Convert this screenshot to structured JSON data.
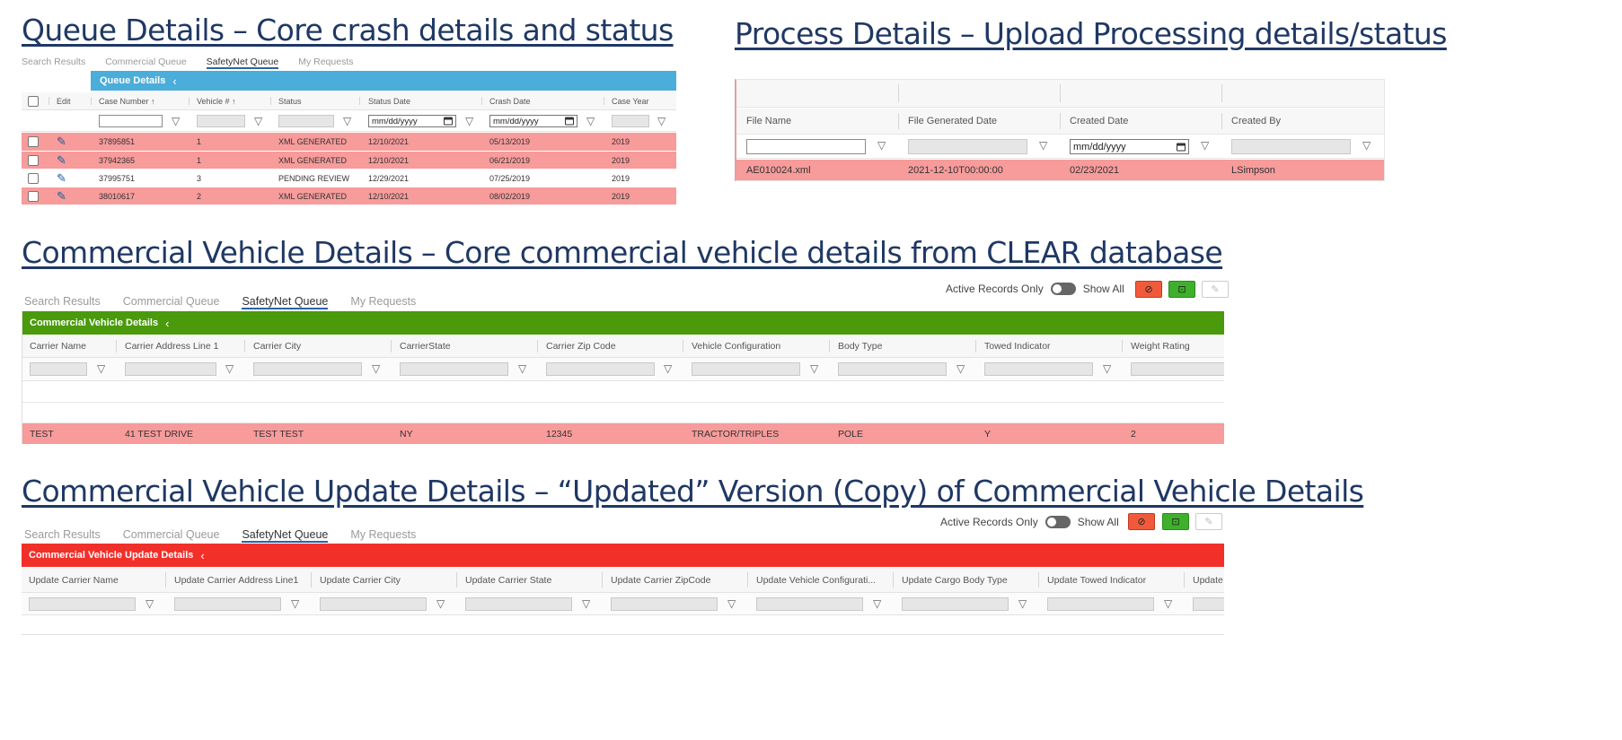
{
  "headings": {
    "queue": "Queue Details – Core crash details and status",
    "process": "Process Details – Upload Processing details/status",
    "commercial": "Commercial Vehicle Details – Core commercial vehicle details from CLEAR database",
    "update": "Commercial Vehicle Update Details – “Updated” Version (Copy) of Commercial Vehicle Details"
  },
  "tabs": [
    "Search Results",
    "Commercial Queue",
    "SafetyNet Queue",
    "My Requests"
  ],
  "queue": {
    "bar_title": "Queue Details",
    "bar_color": "#4badd9",
    "columns": [
      "Edit",
      "Case Number ↑",
      "Vehicle # ↑",
      "Status",
      "Status Date",
      "Crash Date",
      "Case Year"
    ],
    "date_placeholder": "mm/dd/yyyy",
    "rows": [
      {
        "case": "37895851",
        "vehicle": "1",
        "status": "XML GENERATED",
        "status_date": "12/10/2021",
        "crash_date": "05/13/2019",
        "year": "2019"
      },
      {
        "case": "37942365",
        "vehicle": "1",
        "status": "XML GENERATED",
        "status_date": "12/10/2021",
        "crash_date": "06/21/2019",
        "year": "2019"
      },
      {
        "case": "37995751",
        "vehicle": "3",
        "status": "PENDING REVIEW",
        "status_date": "12/29/2021",
        "crash_date": "07/25/2019",
        "year": "2019"
      },
      {
        "case": "38010617",
        "vehicle": "2",
        "status": "XML GENERATED",
        "status_date": "12/10/2021",
        "crash_date": "08/02/2019",
        "year": "2019"
      }
    ]
  },
  "process": {
    "columns": [
      "File Name",
      "File Generated Date",
      "Created Date",
      "Created By"
    ],
    "date_placeholder": "mm/dd/yyyy",
    "row": {
      "file": "AE010024.xml",
      "generated": "2021-12-10T00:00:00",
      "created": "02/23/2021",
      "by": "LSimpson"
    }
  },
  "commercial": {
    "bar_title": "Commercial Vehicle Details",
    "bar_color": "#4a9a0c",
    "toggle_left": "Active Records Only",
    "toggle_right": "Show All",
    "columns": [
      "Carrier Name",
      "Carrier Address Line 1",
      "Carrier City",
      "CarrierState",
      "Carrier Zip Code",
      "Vehicle Configuration",
      "Body Type",
      "Towed Indicator",
      "Weight Rating"
    ],
    "row": [
      "TEST",
      "41 TEST DRIVE",
      "TEST TEST",
      "NY",
      "12345",
      "TRACTOR/TRIPLES",
      "POLE",
      "Y",
      "2"
    ]
  },
  "update": {
    "bar_title": "Commercial Vehicle Update Details",
    "bar_color": "#f1302a",
    "toggle_left": "Active Records Only",
    "toggle_right": "Show All",
    "columns": [
      "Update Carrier Name",
      "Update Carrier Address Line1",
      "Update Carrier City",
      "Update Carrier State",
      "Update Carrier ZipCode",
      "Update Vehicle Configurati...",
      "Update Cargo Body Type",
      "Update Towed Indicator",
      "Update V"
    ]
  }
}
